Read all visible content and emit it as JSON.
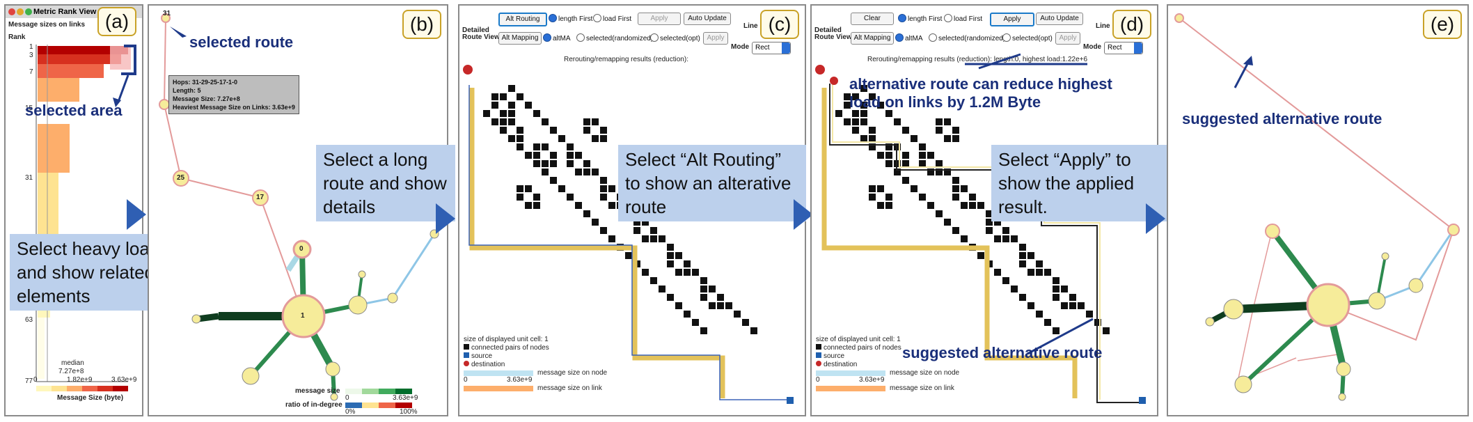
{
  "panel_labels": [
    "(a)",
    "(b)",
    "(c)",
    "(d)",
    "(e)"
  ],
  "panel_a": {
    "window_title": "Metric Rank View",
    "subtitle": "Message sizes on links",
    "rank_label": "Rank",
    "rank_ticks": [
      "1",
      "3",
      "7",
      "15",
      "31",
      "63",
      "77"
    ],
    "median_label": "median",
    "median_value": "7.27e+8",
    "axis_ticks": [
      "0",
      "1.82e+9",
      "3.63e+9"
    ],
    "axis_title": "Message Size (byte)",
    "ann_selected_area": "selected area",
    "callout": "Select heavy loads  and show related elements"
  },
  "panel_b": {
    "top_node": "31",
    "ann_selected_route": "selected route",
    "tooltip": {
      "hops": "Hops: 31-29-25-17-1-0",
      "length": "Length: 5",
      "msg_size": "Message Size: 7.27e+8",
      "heaviest": "Heaviest Message Size on Links: 3.63e+9"
    },
    "node_labels": [
      "25",
      "17",
      "0",
      "1"
    ],
    "legend_msg": "message size",
    "legend_ratio": "ratio of in-degree",
    "legend_v1": "0",
    "legend_v2": "3.63e+9",
    "legend_v3": "0%",
    "legend_v4": "100%",
    "callout": "Select a long route and show details"
  },
  "panel_c": {
    "btn_alt_routing": "Alt Routing",
    "r_length_first": "length First",
    "r_load_first": "load First",
    "btn_apply": "Apply",
    "btn_auto_update": "Auto Update",
    "line_label": "Line",
    "detailed_label": "Detailed",
    "route_view_label": "Route View",
    "btn_alt_mapping": "Alt Mapping",
    "r_alma": "altMA",
    "r_sel_rand": "selected(randomized)",
    "r_sel_opt": "selected(opt)",
    "btn_apply2": "Apply",
    "mode_label": "Mode",
    "mode_value": "Rect",
    "results_title": "Rerouting/remapping results (reduction):",
    "callout": "Select “Alt Routing” to show an alterative route",
    "legend": {
      "cell": "size of displayed unit cell: 1",
      "pairs": "connected pairs of nodes",
      "source": "source",
      "destination": "destination",
      "msg_node": "message size on node",
      "msg_link": "message size on link",
      "v0": "0",
      "vmax": "3.63e+9"
    }
  },
  "panel_d": {
    "btn_clear": "Clear",
    "r_length_first": "length First",
    "r_load_first": "load First",
    "btn_apply": "Apply",
    "btn_auto_update": "Auto Update",
    "line_label": "Line",
    "detailed_label": "Detailed",
    "route_view_label": "Route View",
    "btn_alt_mapping": "Alt Mapping",
    "r_alma": "altMA",
    "r_sel_rand": "selected(randomized)",
    "r_sel_opt": "selected(opt)",
    "btn_apply2": "Apply",
    "mode_label": "Mode",
    "mode_value": "Rect",
    "results_title": "Rerouting/remapping results (reduction): length:0, highest load:1.22e+6",
    "ann_reduce_1": "alternative route can reduce highest",
    "ann_reduce_2": "load on links by 1.2M Byte",
    "ann_suggested": "suggested alternative route",
    "callout": "Select “Apply” to show the applied result.",
    "legend": {
      "cell": "size of displayed unit cell: 1",
      "pairs": "connected pairs of nodes",
      "source": "source",
      "destination": "destination",
      "msg_node": "message size on node",
      "msg_link": "message size on link",
      "v0": "0",
      "vmax": "3.63e+9"
    }
  },
  "panel_e": {
    "ann_suggested": "suggested alternative route"
  },
  "colors": {
    "arrow": "#2f5fb3",
    "annotation": "#1a2f7a",
    "callout_bg": "#bcd0ec",
    "route_gold": "#e3c25a",
    "edge_green": "#2d8a4e",
    "edge_dark": "#0f3d1f",
    "node_yellow": "#f6ec9a",
    "node_pink": "#e39a9a",
    "bar_red": "#d7301f"
  }
}
